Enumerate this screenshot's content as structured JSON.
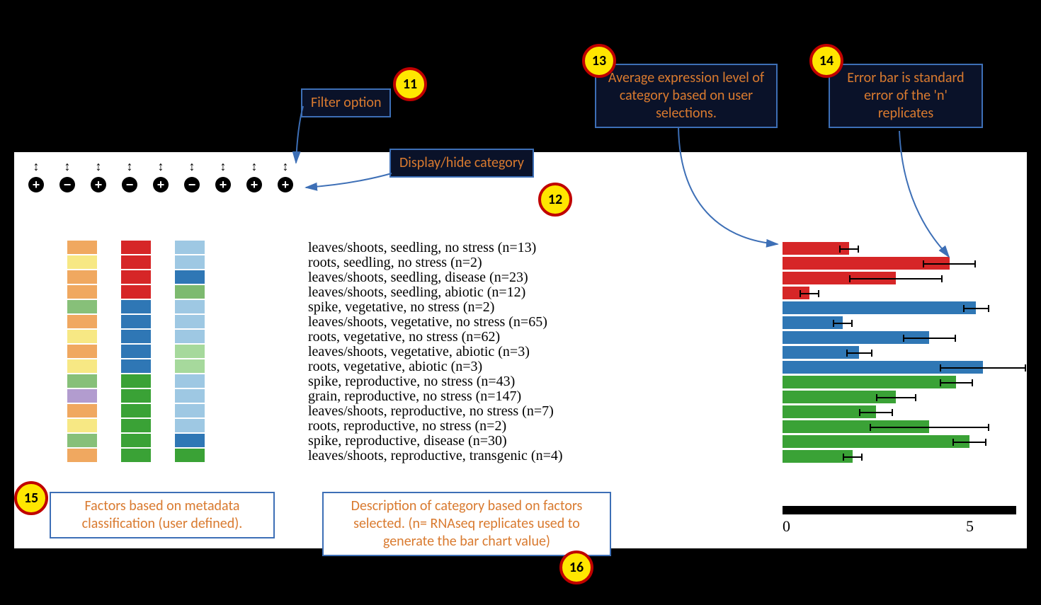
{
  "callouts": {
    "c11": "Filter option",
    "c12": "Display/hide category",
    "c13": "Average expression level of category based on user selections.",
    "c14": "Error bar is standard error of the 'n' replicates",
    "c15": "Factors based on metadata classification (user defined).",
    "c16": "Description of category based on factors selected. (n= RNAseq replicates used to generate the bar chart value)"
  },
  "badges": {
    "b11": "11",
    "b12": "12",
    "b13": "13",
    "b14": "14",
    "b15": "15",
    "b16": "16"
  },
  "controls": {
    "sort": [
      "↕",
      "↕",
      "↕",
      "↕",
      "↕",
      "↕",
      "↕",
      "↕",
      "↕"
    ],
    "toggle": [
      "+",
      "−",
      "+",
      "−",
      "+",
      "−",
      "+",
      "+",
      "+"
    ]
  },
  "chart_data": {
    "type": "bar",
    "xlabel": "",
    "ylabel": "",
    "xlim": [
      0,
      7
    ],
    "ticks": [
      "0",
      "5"
    ],
    "rows": [
      {
        "desc": "leaves/shoots, seedling, no stress (n=13)",
        "factors": [
          "#f0a860",
          "#d62627",
          "#9ec8e3"
        ],
        "value": 2.0,
        "err": 0.3,
        "color": "#d62627"
      },
      {
        "desc": "roots, seedling, no stress (n=2)",
        "factors": [
          "#f7e884",
          "#d62627",
          "#9ec8e3"
        ],
        "value": 5.0,
        "err": 0.8,
        "color": "#d62627"
      },
      {
        "desc": "leaves/shoots, seedling, disease (n=23)",
        "factors": [
          "#f0a860",
          "#d62627",
          "#2f77b5"
        ],
        "value": 3.4,
        "err": 1.4,
        "color": "#d62627"
      },
      {
        "desc": "leaves/shoots, seedling, abiotic (n=12)",
        "factors": [
          "#f0a860",
          "#d62627",
          "#7dba6f"
        ],
        "value": 0.8,
        "err": 0.3,
        "color": "#d62627"
      },
      {
        "desc": "spike, vegetative, no stress (n=2)",
        "factors": [
          "#87c079",
          "#2f77b5",
          "#9ec8e3"
        ],
        "value": 5.8,
        "err": 0.4,
        "color": "#2f77b5"
      },
      {
        "desc": "leaves/shoots, vegetative, no stress (n=65)",
        "factors": [
          "#f0a860",
          "#2f77b5",
          "#9ec8e3"
        ],
        "value": 1.8,
        "err": 0.3,
        "color": "#2f77b5"
      },
      {
        "desc": "roots, vegetative, no stress (n=62)",
        "factors": [
          "#f7e884",
          "#2f77b5",
          "#9ec8e3"
        ],
        "value": 4.4,
        "err": 0.8,
        "color": "#2f77b5"
      },
      {
        "desc": "leaves/shoots, vegetative, abiotic (n=3)",
        "factors": [
          "#f0a860",
          "#2f77b5",
          "#a6d99c"
        ],
        "value": 2.3,
        "err": 0.4,
        "color": "#2f77b5"
      },
      {
        "desc": "roots, vegetative, abiotic (n=3)",
        "factors": [
          "#f7e884",
          "#2f77b5",
          "#a6d99c"
        ],
        "value": 6.0,
        "err": 1.3,
        "color": "#2f77b5"
      },
      {
        "desc": "spike, reproductive, no stress (n=43)",
        "factors": [
          "#87c079",
          "#3aa236",
          "#9ec8e3"
        ],
        "value": 5.2,
        "err": 0.5,
        "color": "#3aa236"
      },
      {
        "desc": "grain, reproductive, no stress (n=147)",
        "factors": [
          "#b29ccf",
          "#3aa236",
          "#9ec8e3"
        ],
        "value": 3.4,
        "err": 0.6,
        "color": "#3aa236"
      },
      {
        "desc": "leaves/shoots, reproductive, no stress (n=7)",
        "factors": [
          "#f0a860",
          "#3aa236",
          "#9ec8e3"
        ],
        "value": 2.8,
        "err": 0.5,
        "color": "#3aa236"
      },
      {
        "desc": "roots, reproductive, no stress (n=2)",
        "factors": [
          "#f7e884",
          "#3aa236",
          "#9ec8e3"
        ],
        "value": 4.4,
        "err": 1.8,
        "color": "#3aa236"
      },
      {
        "desc": "spike, reproductive, disease (n=30)",
        "factors": [
          "#87c079",
          "#3aa236",
          "#2f77b5"
        ],
        "value": 5.6,
        "err": 0.5,
        "color": "#3aa236"
      },
      {
        "desc": "leaves/shoots, reproductive, transgenic (n=4)",
        "factors": [
          "#f0a860",
          "#3aa236",
          "#3aa236"
        ],
        "value": 2.1,
        "err": 0.3,
        "color": "#3aa236"
      }
    ]
  }
}
